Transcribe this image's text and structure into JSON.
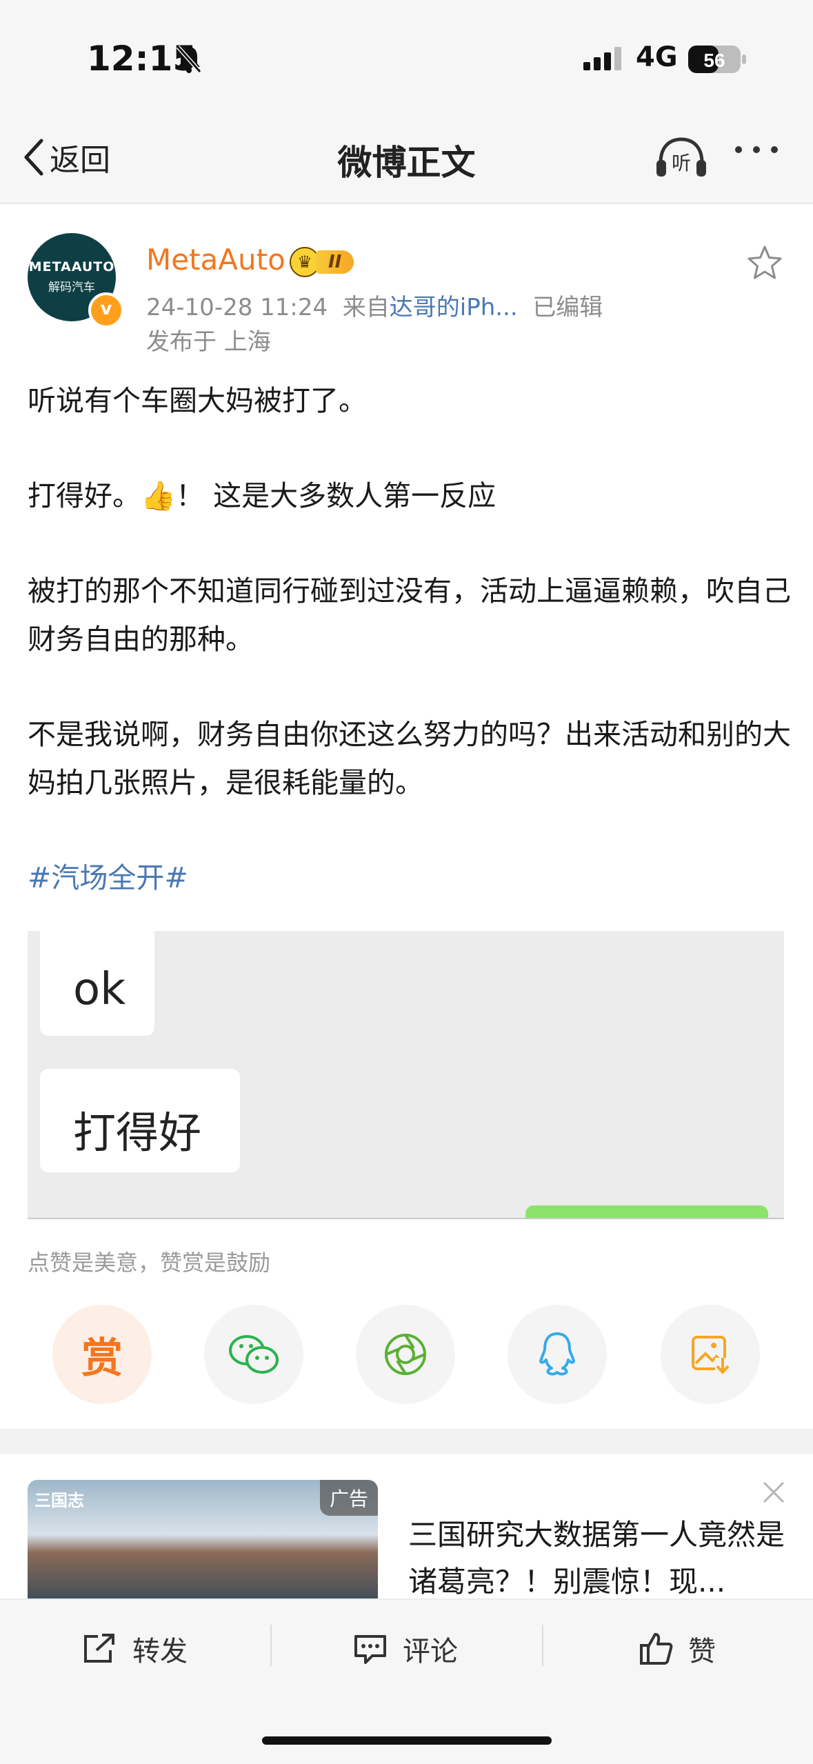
{
  "status_bar": {
    "time": "12:15",
    "network": "4G",
    "battery": "56"
  },
  "nav": {
    "back_label": "返回",
    "title": "微博正文",
    "listen_label": "听"
  },
  "post": {
    "username": "MetaAuto",
    "vip_level": "II",
    "avatar_text_line1": "METAAUTO",
    "avatar_text_line2": "解码汽车",
    "verified_mark": "v",
    "date": "24-10-28 11:24",
    "source_prefix": "来自",
    "source": "达哥的iPh...",
    "edited": "已编辑",
    "location": "发布于 上海",
    "paragraphs": [
      "听说有个车圈大妈被打了。",
      "打得好。👍！ 这是大多数人第一反应",
      "被打的那个不知道同行碰到过没有，活动上逼逼赖赖，吹自己财务自由的那种。",
      "不是我说啊，财务自由你还这么努力的吗？出来活动和别的大妈拍几张照片，是很耗能量的。"
    ],
    "hashtag": "#汽场全开#",
    "image_bubbles": [
      "ok",
      "打得好"
    ],
    "reward_tip": "点赞是美意，赞赏是鼓励",
    "reward_label": "赏"
  },
  "share_icons": [
    "reward-icon",
    "wechat-icon",
    "moments-icon",
    "qq-icon",
    "save-image-icon"
  ],
  "ad": {
    "tag": "广告",
    "logo": "三国志",
    "text": "三国研究大数据第一人竟然是诸葛亮？！别震惊！现..."
  },
  "bottom_bar": {
    "repost": "转发",
    "comment": "评论",
    "like": "赞"
  },
  "colors": {
    "accent_orange": "#f3761f",
    "link_blue": "#4a78b5",
    "wechat_green": "#2bb24c",
    "qq_blue": "#36a9e8"
  }
}
